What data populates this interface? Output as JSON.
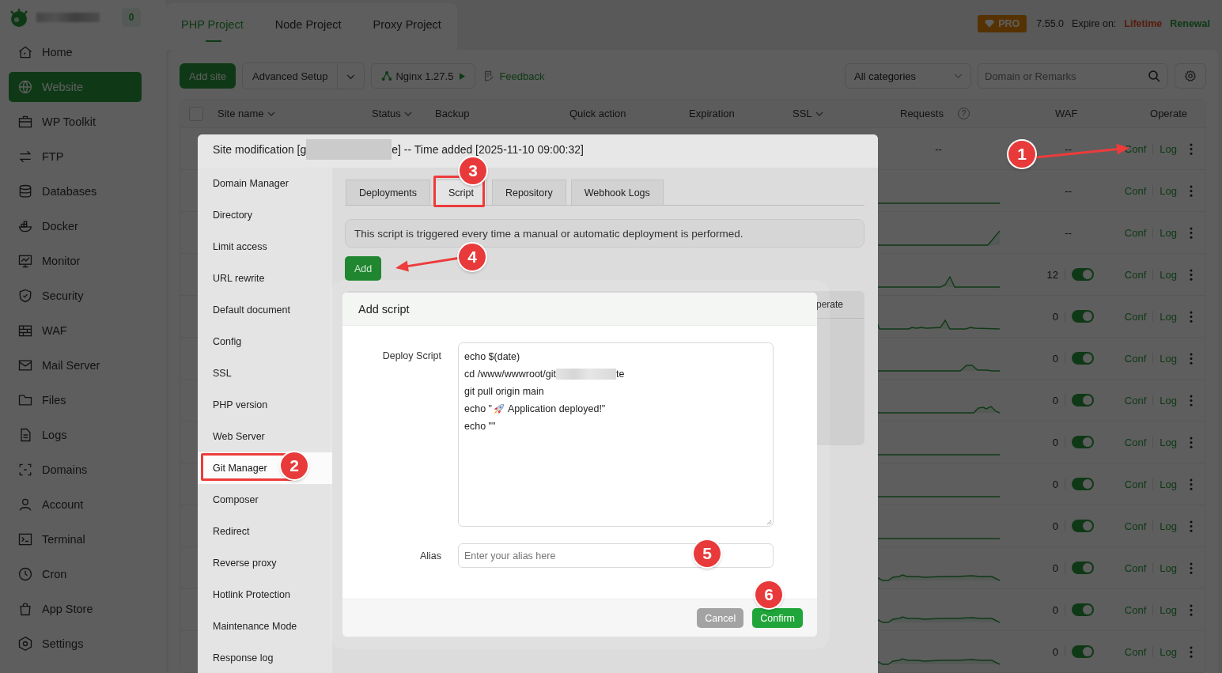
{
  "sidebar": {
    "badge": "0",
    "items": [
      {
        "label": "Home",
        "selected": false
      },
      {
        "label": "Website",
        "selected": true
      },
      {
        "label": "WP Toolkit",
        "selected": false
      },
      {
        "label": "FTP",
        "selected": false
      },
      {
        "label": "Databases",
        "selected": false
      },
      {
        "label": "Docker",
        "selected": false
      },
      {
        "label": "Monitor",
        "selected": false
      },
      {
        "label": "Security",
        "selected": false
      },
      {
        "label": "WAF",
        "selected": false
      },
      {
        "label": "Mail Server",
        "selected": false
      },
      {
        "label": "Files",
        "selected": false
      },
      {
        "label": "Logs",
        "selected": false
      },
      {
        "label": "Domains",
        "selected": false
      },
      {
        "label": "Account",
        "selected": false
      },
      {
        "label": "Terminal",
        "selected": false
      },
      {
        "label": "Cron",
        "selected": false
      },
      {
        "label": "App Store",
        "selected": false
      },
      {
        "label": "Settings",
        "selected": false
      }
    ]
  },
  "tabs": [
    {
      "label": "PHP Project",
      "selected": true
    },
    {
      "label": "Node Project",
      "selected": false
    },
    {
      "label": "Proxy Project",
      "selected": false
    }
  ],
  "header_info": {
    "plan": "PRO",
    "version": "7.55.0",
    "expire_label": "Expire on:",
    "expire_value": "Lifetime",
    "renewal": "Renewal"
  },
  "toolbar": {
    "add_site": "Add site",
    "advanced": "Advanced Setup",
    "nginx": "Nginx 1.27.5",
    "feedback": "Feedback",
    "category": "All categories",
    "search_placeholder": "Domain or Remarks"
  },
  "table": {
    "select_all_checked": false,
    "columns": [
      {
        "label": "Site name",
        "sortable": true
      },
      {
        "label": "Status",
        "sortable": true
      },
      {
        "label": "Backup",
        "sortable": false
      },
      {
        "label": "Quick action",
        "sortable": false
      },
      {
        "label": "Expiration",
        "sortable": false
      },
      {
        "label": "SSL",
        "sortable": true
      },
      {
        "label": "Requests",
        "sortable": false,
        "help": "?"
      },
      {
        "label": "WAF",
        "sortable": false
      },
      {
        "label": "Operate",
        "sortable": false
      }
    ],
    "rows": [
      {
        "requests": "--",
        "waf": "--",
        "conf": "Conf",
        "log": "Log"
      },
      {
        "waf": "--",
        "conf": "Conf",
        "log": "Log"
      },
      {
        "waf": "--",
        "conf": "Conf",
        "log": "Log"
      },
      {
        "waf": "12",
        "waf_on": true,
        "conf": "Conf",
        "log": "Log"
      },
      {
        "waf": "0",
        "waf_on": true,
        "conf": "Conf",
        "log": "Log"
      },
      {
        "waf": "0",
        "waf_on": true,
        "conf": "Conf",
        "log": "Log"
      },
      {
        "waf": "0",
        "waf_on": true,
        "conf": "Conf",
        "log": "Log"
      },
      {
        "waf": "0",
        "waf_on": true,
        "conf": "Conf",
        "log": "Log"
      },
      {
        "waf": "0",
        "waf_on": true,
        "conf": "Conf",
        "log": "Log"
      },
      {
        "waf": "0",
        "waf_on": true,
        "conf": "Conf",
        "log": "Log"
      },
      {
        "waf": "0",
        "waf_on": true,
        "conf": "Conf",
        "log": "Log"
      },
      {
        "waf": "0",
        "waf_on": true,
        "conf": "Conf",
        "log": "Log"
      },
      {
        "waf": "0",
        "waf_on": true,
        "conf": "Conf",
        "log": "Log"
      }
    ]
  },
  "site_modal": {
    "title_parts": [
      {
        "kind": "text",
        "text": "Site modification [g"
      },
      {
        "kind": "redacted"
      },
      {
        "kind": "text",
        "text": "e] -- Time added [2025-11-10 09:00:32]"
      }
    ],
    "menu": [
      {
        "label": "Domain Manager",
        "selected": false
      },
      {
        "label": "Directory",
        "selected": false
      },
      {
        "label": "Limit access",
        "selected": false
      },
      {
        "label": "URL rewrite",
        "selected": false
      },
      {
        "label": "Default document",
        "selected": false
      },
      {
        "label": "Config",
        "selected": false
      },
      {
        "label": "SSL",
        "selected": false
      },
      {
        "label": "PHP version",
        "selected": false
      },
      {
        "label": "Web Server",
        "selected": false
      },
      {
        "label": "Git Manager",
        "selected": true
      },
      {
        "label": "Composer",
        "selected": false
      },
      {
        "label": "Redirect",
        "selected": false
      },
      {
        "label": "Reverse proxy",
        "selected": false
      },
      {
        "label": "Hotlink Protection",
        "selected": false
      },
      {
        "label": "Maintenance Mode",
        "selected": false
      },
      {
        "label": "Response log",
        "selected": false
      }
    ],
    "tabs": [
      {
        "label": "Deployments",
        "selected": false
      },
      {
        "label": "Script",
        "selected": true
      },
      {
        "label": "Repository",
        "selected": false
      },
      {
        "label": "Webhook Logs",
        "selected": false
      }
    ],
    "notice": "This script is triggered every time a manual or automatic deployment is performed.",
    "add_button": "Add",
    "table_header_fragment": "perate"
  },
  "dialog": {
    "title": "Add script",
    "script_label": "Deploy Script",
    "script_lines": [
      [
        {
          "kind": "text",
          "text": "echo $(date)"
        }
      ],
      [
        {
          "kind": "text",
          "text": "cd /www/wwwroot/git"
        },
        {
          "kind": "redacted"
        },
        {
          "kind": "text",
          "text": "te"
        }
      ],
      [
        {
          "kind": "text",
          "text": "git pull origin main"
        }
      ],
      [
        {
          "kind": "text",
          "text": "echo \""
        },
        {
          "kind": "icon"
        },
        {
          "kind": "text",
          "text": "Application deployed!\""
        }
      ],
      [
        {
          "kind": "text",
          "text": "echo \"\""
        }
      ]
    ],
    "alias_label": "Alias",
    "alias_placeholder": "Enter your alias here",
    "buttons": [
      {
        "label": "Cancel",
        "kind": "cancel",
        "disabled": true
      },
      {
        "label": "Confirm",
        "kind": "confirm",
        "disabled": false
      }
    ]
  },
  "annotations": [
    {
      "number": "1",
      "kind": "arrow"
    },
    {
      "number": "2",
      "kind": "frame"
    },
    {
      "number": "3",
      "kind": "frame"
    },
    {
      "number": "4",
      "kind": "arrow"
    },
    {
      "number": "5",
      "kind": "plain"
    },
    {
      "number": "6",
      "kind": "plain"
    }
  ]
}
